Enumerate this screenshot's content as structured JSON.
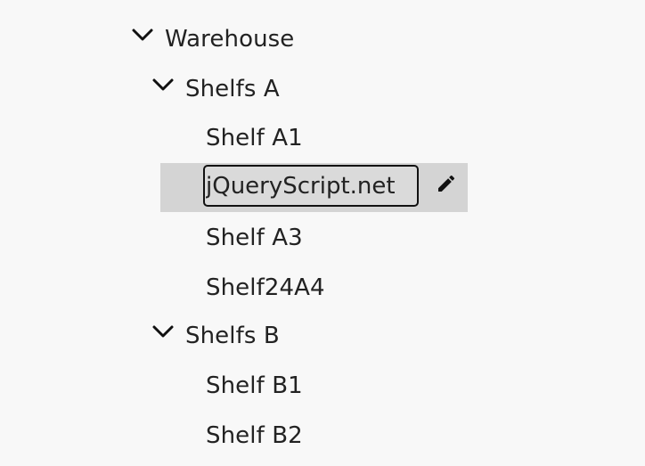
{
  "tree": {
    "root": {
      "label": "Warehouse",
      "expand_icon": "chevron-down-icon"
    },
    "group_a": {
      "label": "Shelfs A",
      "expand_icon": "chevron-down-icon",
      "items": [
        {
          "label": "Shelf A1"
        },
        {
          "value": "jQueryScript.net",
          "edit_icon": "pencil-icon"
        },
        {
          "label": "Shelf A3"
        },
        {
          "label": "Shelf24A4"
        }
      ]
    },
    "group_b": {
      "label": "Shelfs B",
      "expand_icon": "chevron-down-icon",
      "items": [
        {
          "label": "Shelf B1"
        },
        {
          "label": "Shelf B2"
        }
      ]
    }
  },
  "colors": {
    "background": "#f8f8f8",
    "selected_row": "#d4d4d4",
    "text": "#222222"
  }
}
